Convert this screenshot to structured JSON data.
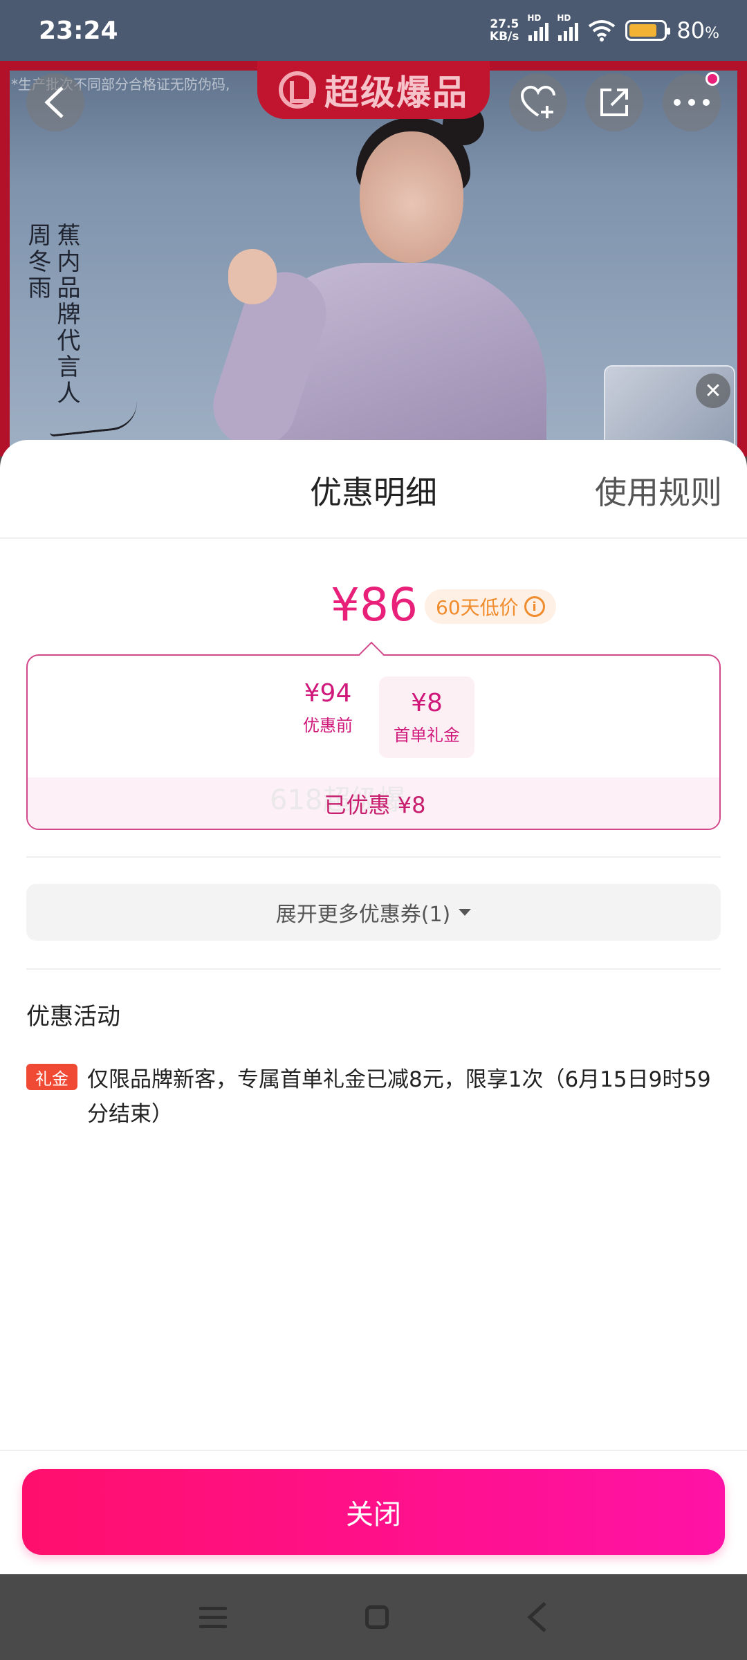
{
  "status_bar": {
    "time": "23:24",
    "net_speed_value": "27.5",
    "net_speed_unit": "KB/s",
    "signal_label": "HD",
    "battery_level": 0.8,
    "battery_percent": "80",
    "battery_unit": "%"
  },
  "hero": {
    "note_text": "*生产批次不同部分合格证无防伪码,",
    "badge_text": "超级爆品",
    "vertical_name": "周冬雨",
    "vertical_title": "蕉内品牌代言人",
    "colors": {
      "frame": "#b3112a",
      "accent": "#e8207a"
    }
  },
  "sheet": {
    "title": "优惠明细",
    "rules_link": "使用规则",
    "final_price": "¥86",
    "low_price_tag": "60天低价",
    "calc": {
      "before_value": "¥94",
      "before_label": "优惠前",
      "minus": "-",
      "gift_value": "¥8",
      "gift_label": "首单礼金",
      "saved_text": "已优惠 ¥8",
      "ghost_text": "618超级爆"
    },
    "expand_label": "展开更多优惠券(1)",
    "activity_section_title": "优惠活动",
    "activities": [
      {
        "tag": "礼金",
        "text": "仅限品牌新客，专属首单礼金已减8元，限享1次（6月15日9时59分结束）"
      }
    ],
    "close_label": "关闭",
    "colors": {
      "price": "#e8207a",
      "tag_orange": "#f08c2c",
      "gift_tag": "#f04a35"
    }
  }
}
